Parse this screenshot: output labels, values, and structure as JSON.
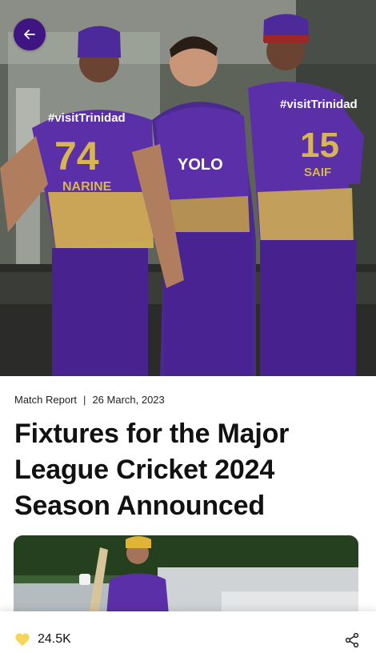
{
  "hero": {
    "jersey_sponsor": "#visitTrinidad",
    "player_left": {
      "number": "74",
      "name": "NARINE"
    },
    "player_right": {
      "number": "15",
      "name": "SAIF"
    },
    "sponsor_center": "YOLO"
  },
  "article": {
    "category": "Match Report",
    "separator": "|",
    "date": "26 March, 2023",
    "headline": "Fixtures for the Major League Cricket 2024 Season Announced"
  },
  "bottom_bar": {
    "likes_count": "24.5K"
  },
  "colors": {
    "accent_purple": "#3f1582",
    "jersey_purple": "#5b2fa8",
    "jersey_gold": "#d7b552",
    "heart": "#f7d55b"
  },
  "icons": {
    "back": "arrow-left-icon",
    "like": "heart-icon",
    "share": "share-icon"
  }
}
